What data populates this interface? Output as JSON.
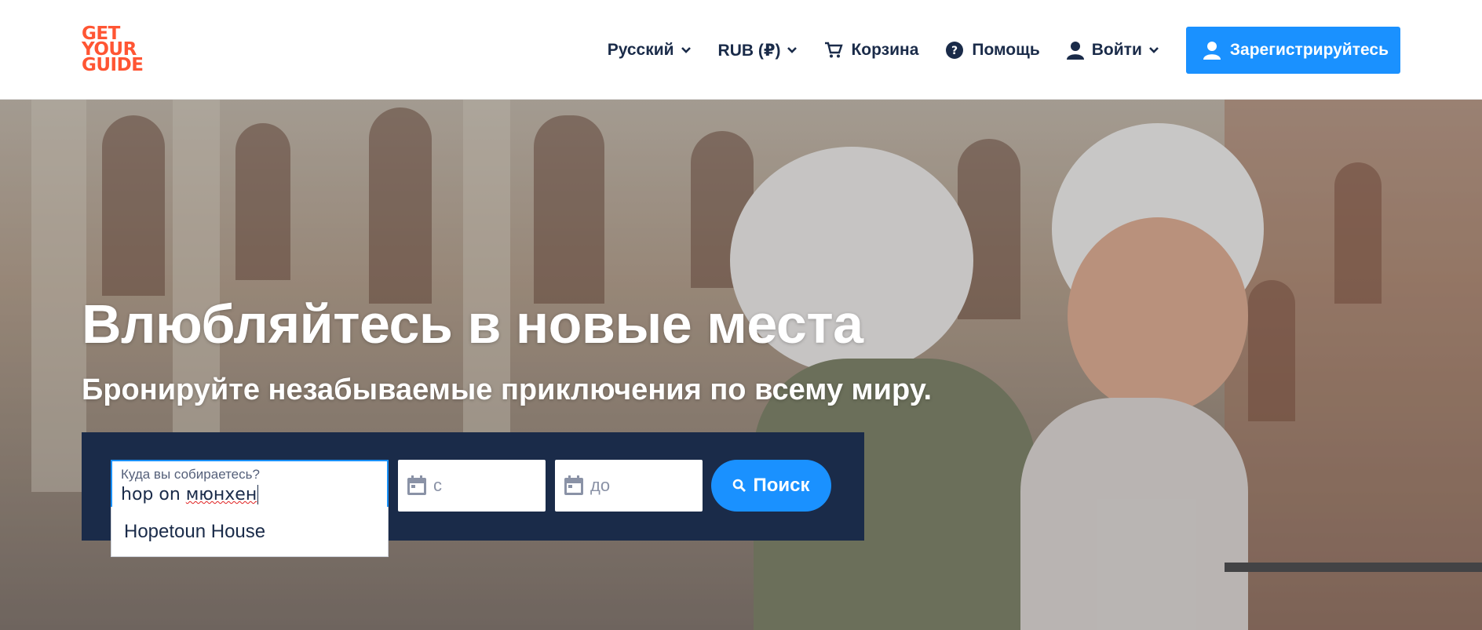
{
  "brand": {
    "logo_lines": [
      "GET",
      "YOUR",
      "GUIDE"
    ],
    "color": "#ff5533"
  },
  "nav": {
    "language": "Русский",
    "currency": "RUB (₽)",
    "cart": "Корзина",
    "help": "Помощь",
    "login": "Войти",
    "signup": "Зарегистрируйтесь"
  },
  "hero": {
    "title": "Влюбляйтесь в новые места",
    "subtitle": "Бронируйте незабываемые приключения по всему миру."
  },
  "search": {
    "destination_label": "Куда вы собираетесь?",
    "destination_value_plain": "hop on ",
    "destination_value_misspelled": "мюнхен",
    "from_placeholder": "с",
    "to_placeholder": "до",
    "button_label": "Поиск"
  },
  "autocomplete": {
    "items": [
      "Hopetoun House"
    ]
  },
  "colors": {
    "navy": "#1a2b49",
    "accent": "#1a91ff",
    "brand": "#ff5533"
  },
  "icons": [
    "chevron-down-icon",
    "cart-icon",
    "help-icon",
    "user-icon",
    "calendar-icon",
    "search-icon"
  ]
}
